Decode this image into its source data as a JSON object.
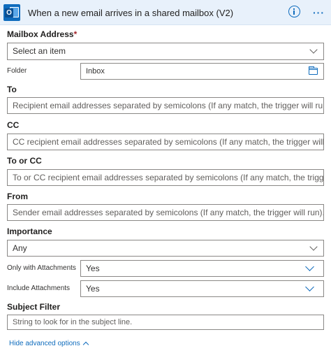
{
  "header": {
    "title": "When a new email arrives in a shared mailbox (V2)",
    "app_icon_letter": "O",
    "accent_color": "#0f6cbd",
    "header_bg": "#e8f1fb"
  },
  "fields": {
    "mailbox": {
      "label": "Mailbox Address",
      "required_mark": "*",
      "placeholder": "Select an item"
    },
    "folder": {
      "label": "Folder",
      "value": "Inbox"
    },
    "to": {
      "label": "To",
      "placeholder": "Recipient email addresses separated by semicolons (If any match, the trigger will run)."
    },
    "cc": {
      "label": "CC",
      "placeholder": "CC recipient email addresses separated by semicolons (If any match, the trigger will run)."
    },
    "to_or_cc": {
      "label": "To or CC",
      "placeholder": "To or CC recipient email addresses separated by semicolons (If any match, the trigger will run)."
    },
    "from": {
      "label": "From",
      "placeholder": "Sender email addresses separated by semicolons (If any match, the trigger will run)."
    },
    "importance": {
      "label": "Importance",
      "value": "Any"
    },
    "only_attachments": {
      "label": "Only with Attachments",
      "value": "Yes"
    },
    "include_attachments": {
      "label": "Include Attachments",
      "value": "Yes"
    },
    "subject_filter": {
      "label": "Subject Filter",
      "placeholder": "String to look for in the subject line."
    }
  },
  "footer": {
    "hide_advanced_label": "Hide advanced options"
  },
  "icons": {
    "app": "outlook-icon",
    "info": "info-icon",
    "more": "more-icon",
    "folder": "folder-icon",
    "chevron": "chevron-down-icon",
    "collapse": "chevron-up-icon"
  }
}
